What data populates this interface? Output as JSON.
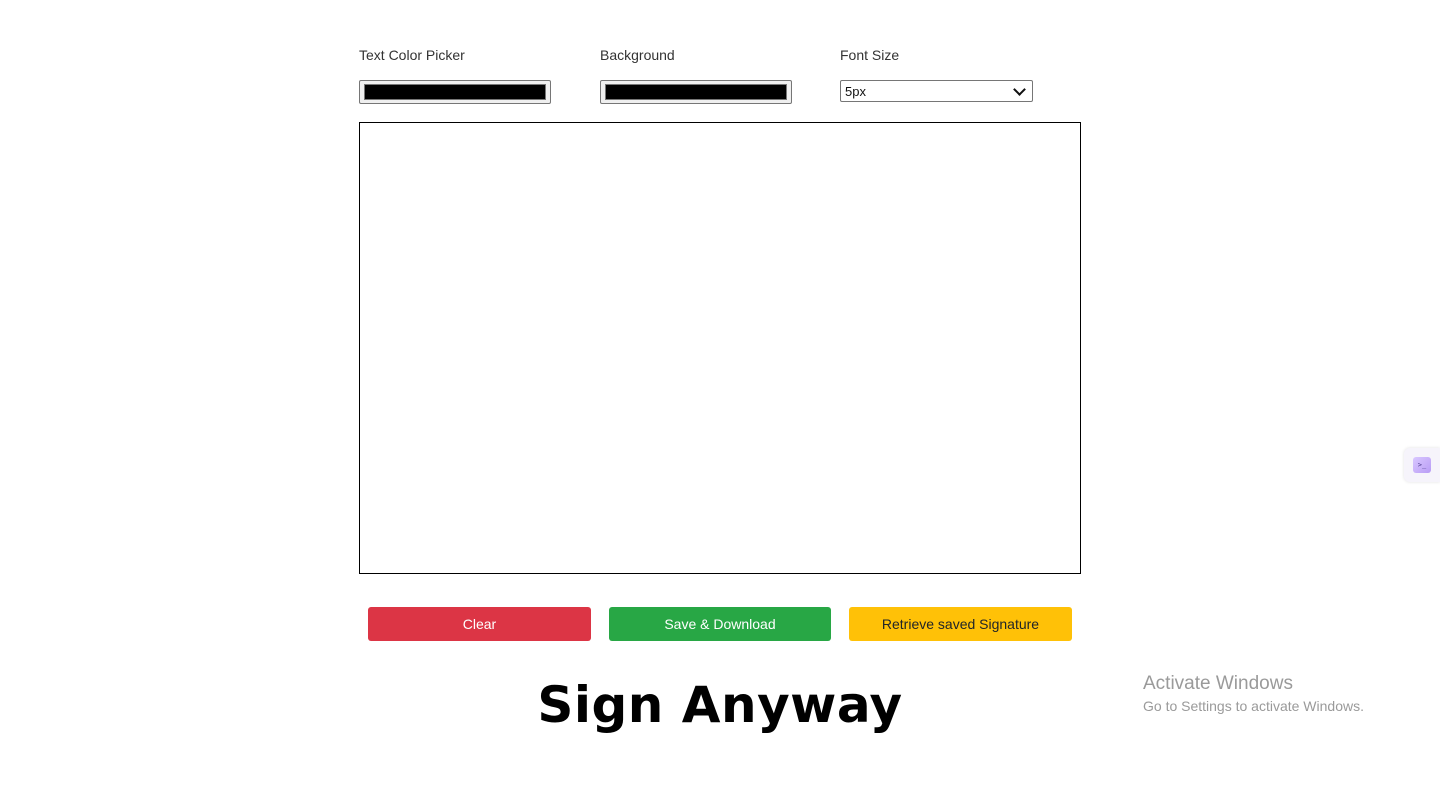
{
  "controls": {
    "text_color_label": "Text Color Picker",
    "text_color_value": "#000000",
    "background_label": "Background",
    "background_value": "#000000",
    "font_size_label": "Font Size",
    "font_size_value": "5px"
  },
  "buttons": {
    "clear": "Clear",
    "save": "Save & Download",
    "retrieve": "Retrieve saved Signature"
  },
  "heading": "Sign Anyway",
  "watermark": {
    "title": "Activate Windows",
    "subtitle": "Go to Settings to activate Windows."
  },
  "colors": {
    "clear_button": "#dc3545",
    "save_button": "#28a745",
    "retrieve_button": "#ffc107"
  },
  "icons": {
    "extension": "browser-extension-icon"
  }
}
